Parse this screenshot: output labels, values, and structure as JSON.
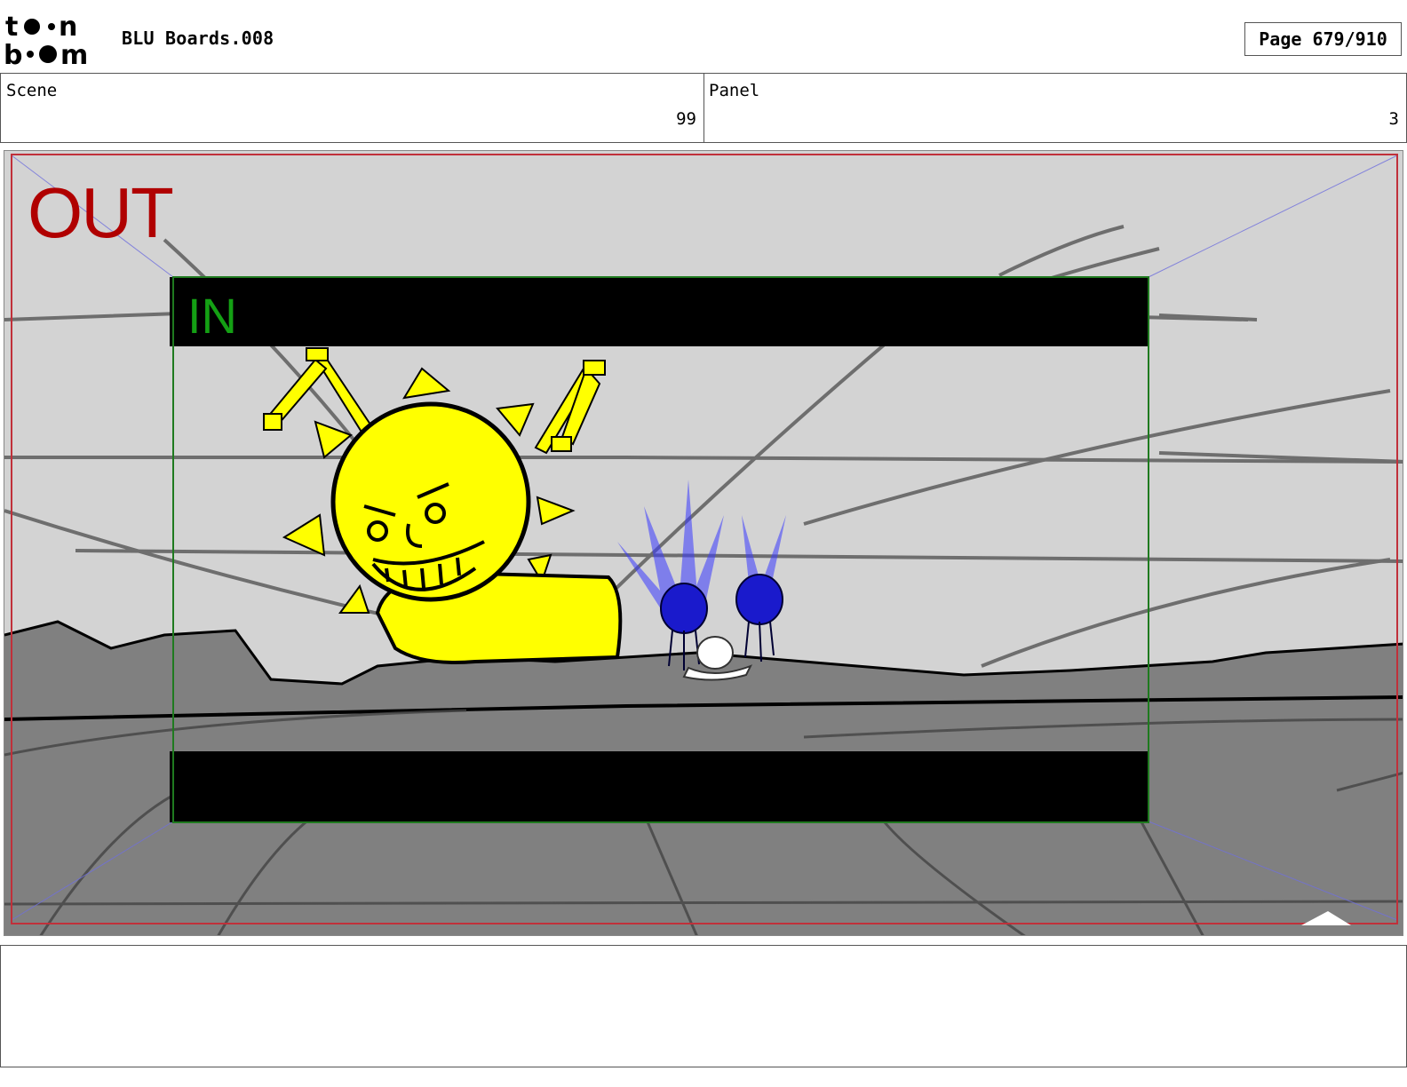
{
  "header": {
    "logo_text": "toon boom",
    "project_title": "BLU Boards.008",
    "page_label": "Page 679/910"
  },
  "info": {
    "scene_label": "Scene",
    "scene_value": "99",
    "panel_label": "Panel",
    "panel_value": "3"
  },
  "frame": {
    "out_label": "OUT",
    "in_label": "IN",
    "colors": {
      "out_border": "#c0303a",
      "in_border": "#1f7a1f",
      "letterbox": "#000000",
      "sky": "#d3d3d3",
      "ground": "#7a7a7a",
      "sun": "#ffff00",
      "creatures": "#1a1acc"
    }
  },
  "notes": {
    "text": ""
  }
}
